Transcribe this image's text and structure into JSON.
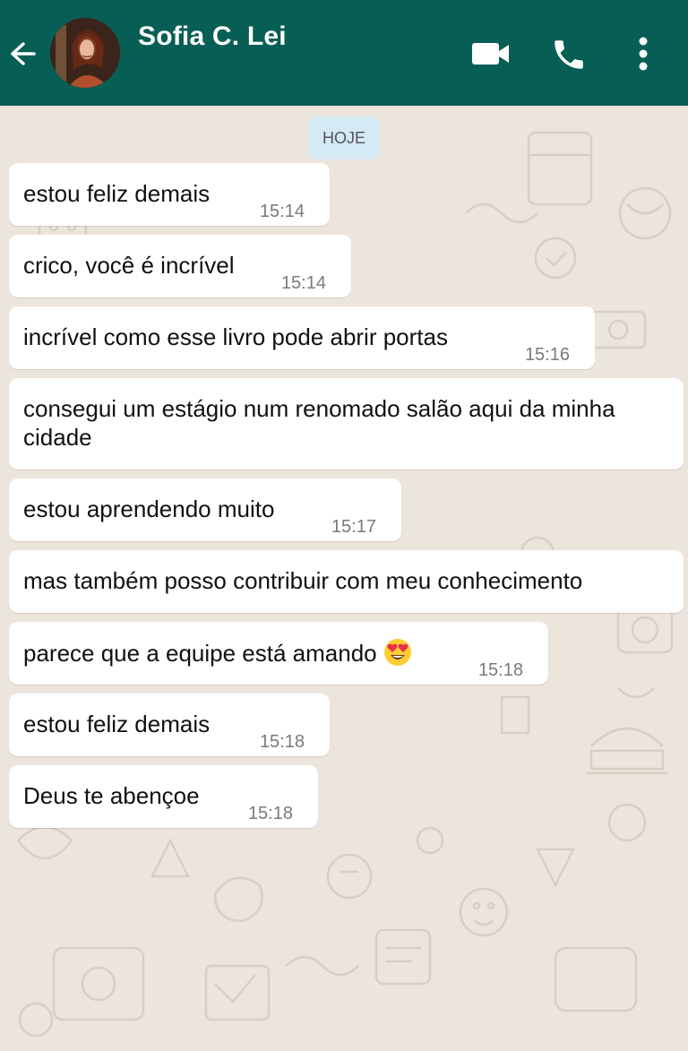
{
  "header": {
    "contact_name": "Sofia C. Lei",
    "icons": {
      "back": "arrow-left-icon",
      "video": "video-camera-icon",
      "call": "phone-icon",
      "menu": "more-vertical-icon"
    },
    "bg_color": "#075e54"
  },
  "chat": {
    "date_label": "HOJE",
    "messages": [
      {
        "text": "estou feliz demais",
        "time": "15:14"
      },
      {
        "text": "crico, você é incrível",
        "time": "15:14"
      },
      {
        "text": "incrível como esse livro pode abrir portas",
        "time": "15:16"
      },
      {
        "text": "consegui um estágio num renomado salão aqui da minha cidade",
        "time": ""
      },
      {
        "text": "estou aprendendo muito",
        "time": "15:17"
      },
      {
        "text": "mas também posso contribuir com meu conhecimento",
        "time": ""
      },
      {
        "text": "parece que a equipe está amando",
        "emoji": "heart-eyes-emoji",
        "time": "15:18"
      },
      {
        "text": "estou feliz demais",
        "time": "15:18"
      },
      {
        "text": "Deus te abençoe",
        "time": "15:18"
      }
    ],
    "bubble_color": "#ffffff",
    "wallpaper_color": "#ece5dd",
    "date_chip_color": "#d4eaf4"
  }
}
